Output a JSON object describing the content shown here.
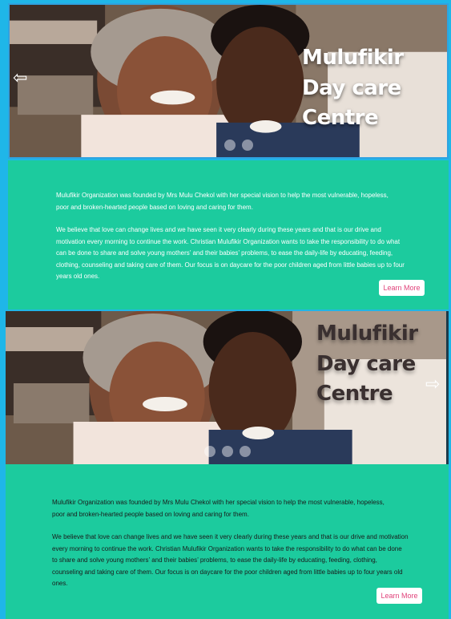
{
  "hero": {
    "title_line1": "Mulufikir",
    "title_line2": "Day care Centre"
  },
  "about": {
    "paragraph1": "Mulufikir Organization was founded by Mrs Mulu Chekol with her special vision to help the most vulnerable, hopeless, poor and broken-hearted people based on loving and caring for them.",
    "paragraph2": "We believe that love can change lives and we have seen it very clearly during these years and that is our drive and motivation every morning to continue the work. Christian Mulufikir Organization wants to take the responsibility to do what can be done to share and solve young mothers’ and their babies’ problems, to ease the daily-life by educating, feeding, clothing, counseling and taking care of them. Our focus is on daycare for the poor children aged from little babies up to four years old ones.",
    "button_label": "Learn More"
  },
  "icons": {
    "prev": "arrow-left-icon",
    "next": "arrow-right-icon"
  },
  "colors": {
    "background": "#1fb6e8",
    "section": "#1ccb9e",
    "button_text": "#e0427a"
  }
}
